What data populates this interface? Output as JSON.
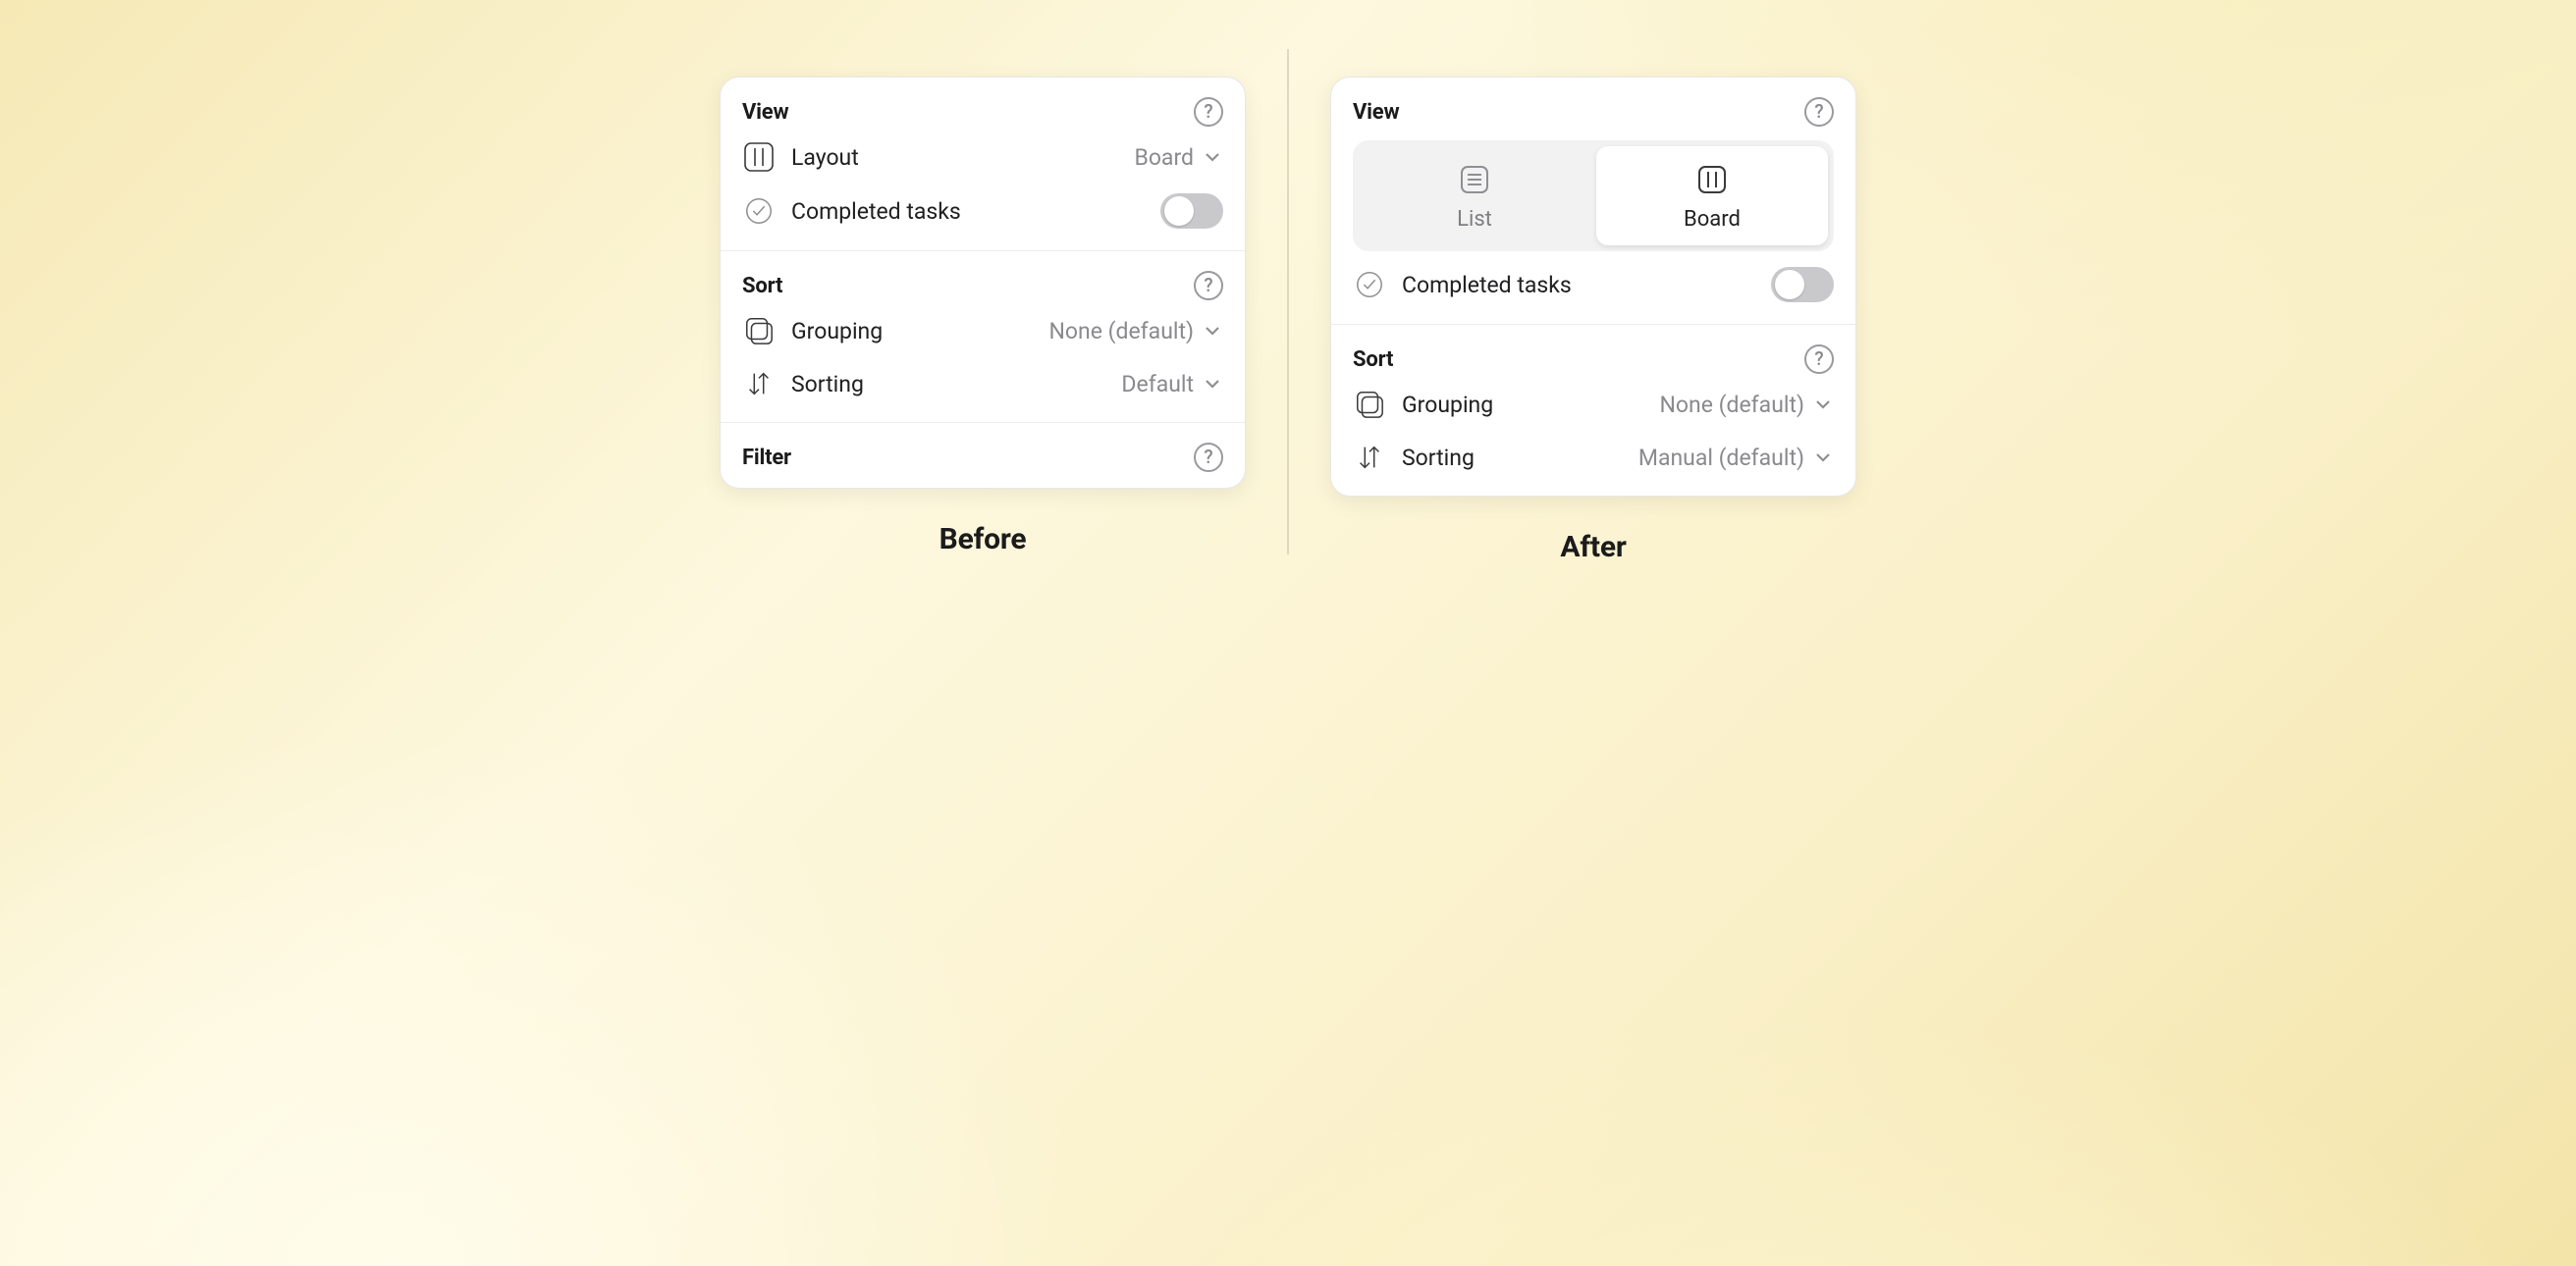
{
  "captions": {
    "before": "Before",
    "after": "After"
  },
  "before": {
    "view": {
      "title": "View",
      "layout_label": "Layout",
      "layout_value": "Board",
      "completed_label": "Completed tasks",
      "completed_on": false
    },
    "sort": {
      "title": "Sort",
      "grouping_label": "Grouping",
      "grouping_value": "None (default)",
      "sorting_label": "Sorting",
      "sorting_value": "Default"
    },
    "filter": {
      "title": "Filter"
    }
  },
  "after": {
    "view": {
      "title": "View",
      "segments": {
        "list": "List",
        "board": "Board"
      },
      "selected_segment": "board",
      "completed_label": "Completed tasks",
      "completed_on": false
    },
    "sort": {
      "title": "Sort",
      "grouping_label": "Grouping",
      "grouping_value": "None (default)",
      "sorting_label": "Sorting",
      "sorting_value": "Manual (default)"
    }
  },
  "help_glyph": "?"
}
